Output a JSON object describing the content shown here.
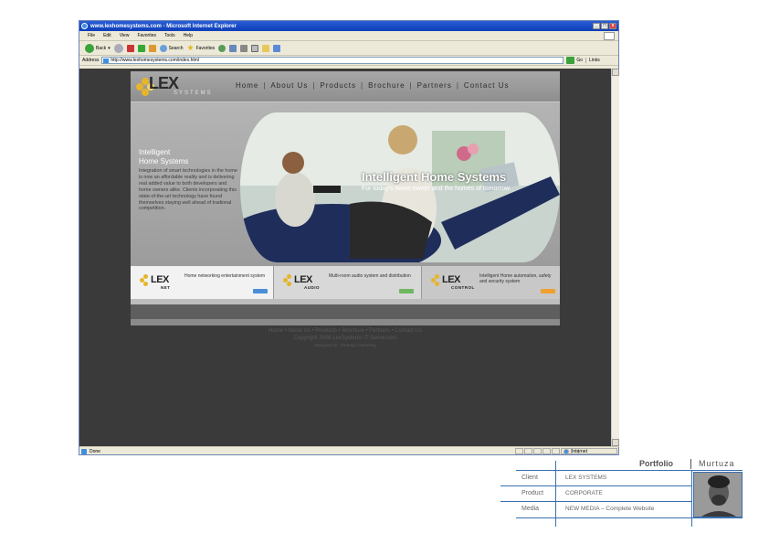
{
  "browser": {
    "title": "www.lexhomesystems.com - Microsoft Internet Explorer",
    "menu": [
      "File",
      "Edit",
      "View",
      "Favorites",
      "Tools",
      "Help"
    ],
    "toolbar": {
      "back": "Back",
      "search": "Search",
      "favorites": "Favorites"
    },
    "address_label": "Address",
    "address_value": "http://www.lexhomesystems.com/index.html",
    "go_label": "Go",
    "links_label": "Links",
    "status_text": "Done",
    "zone_text": "Internet"
  },
  "site": {
    "logo_text": "LEX",
    "logo_sub": "SYSTEMS",
    "nav": [
      "Home",
      "About Us",
      "Products",
      "Brochure",
      "Partners",
      "Contact Us"
    ],
    "hero_title_line1": "Intelligent",
    "hero_title_line2": "Home Systems",
    "hero_body": "Integration of smart technologies in the home is now an affordable reality and is delivering real added value to both developers and home owners alike. Clients incorporating this state-of-the-art technology have found themselves staying well ahead of tradional competition.",
    "photo_title": "Intelligent Home Systems",
    "photo_subtitle": "For today's home owner and the homes of tomorrow",
    "products": [
      {
        "logo": "LEX",
        "sub": "NET",
        "desc": "Home networking entertainment system",
        "color": "#4a8ed8"
      },
      {
        "logo": "LEX",
        "sub": "AUDIO",
        "desc": "Multi-room audio system and distribution",
        "color": "#6fb860"
      },
      {
        "logo": "LEX",
        "sub": "CONTROL",
        "desc": "Intelligent Home automation, safety and security system",
        "color": "#f0a030"
      }
    ],
    "footer_links": "Home • About Us • Products • Brochure • Partners • Contact Us",
    "footer_copyright": "Copyright 2006 LexSystems IT-Serve.com",
    "footer_designed": "Designed by : Strategic Marketing"
  },
  "portfolio": {
    "heading": "Portfolio",
    "author": "Murtuza",
    "rows": [
      {
        "key": "Client",
        "value": "LEX SYSTEMS"
      },
      {
        "key": "Product",
        "value": "CORPORATE"
      },
      {
        "key": "Media",
        "value": "NEW MEDIA – Complete Website"
      }
    ]
  }
}
